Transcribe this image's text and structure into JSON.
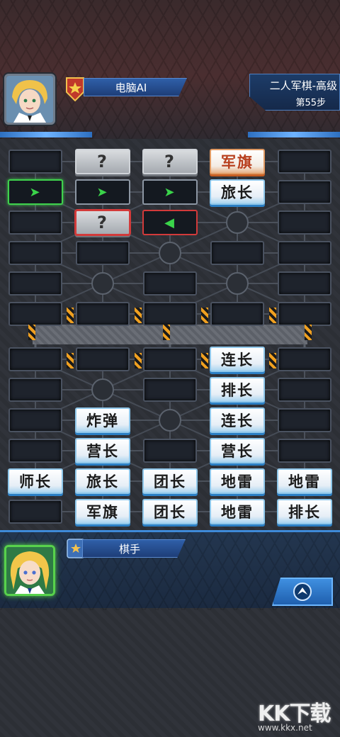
{
  "opponent": {
    "name": "电脑AI"
  },
  "game": {
    "title": "二人军棋-高级",
    "moves": "第55步"
  },
  "player": {
    "name": "棋手"
  },
  "icons": {
    "opponent_badge": "rank-badge-icon",
    "player_badge": "rank-badge-icon",
    "action": "up-arrow-icon"
  },
  "colors": {
    "accent_blue": "#3e8ad8",
    "selected_green": "#3fd14d",
    "highlight_red": "#d23a3a",
    "opp_text": "#b8401e"
  },
  "board": {
    "opponent_pieces": [
      {
        "row": 0,
        "col": 1,
        "label": "?",
        "kind": "hidden"
      },
      {
        "row": 0,
        "col": 2,
        "label": "?",
        "kind": "hidden"
      },
      {
        "row": 0,
        "col": 3,
        "label": "军旗",
        "kind": "revealed"
      },
      {
        "row": 1,
        "col": 0,
        "label": "➤",
        "kind": "marker-green"
      },
      {
        "row": 1,
        "col": 1,
        "label": "➤",
        "kind": "marker"
      },
      {
        "row": 1,
        "col": 2,
        "label": "➤",
        "kind": "marker"
      },
      {
        "row": 1,
        "col": 3,
        "label": "旅长",
        "kind": "mine"
      },
      {
        "row": 2,
        "col": 1,
        "label": "?",
        "kind": "hidden-red"
      },
      {
        "row": 2,
        "col": 2,
        "label": "◀",
        "kind": "marker-red"
      }
    ],
    "player_pieces": [
      {
        "row": 6,
        "col": 3,
        "label": "连长"
      },
      {
        "row": 7,
        "col": 3,
        "label": "排长"
      },
      {
        "row": 8,
        "col": 1,
        "label": "炸弹"
      },
      {
        "row": 8,
        "col": 3,
        "label": "连长"
      },
      {
        "row": 9,
        "col": 1,
        "label": "营长"
      },
      {
        "row": 9,
        "col": 3,
        "label": "营长"
      },
      {
        "row": 10,
        "col": 0,
        "label": "师长"
      },
      {
        "row": 10,
        "col": 1,
        "label": "旅长"
      },
      {
        "row": 10,
        "col": 2,
        "label": "团长"
      },
      {
        "row": 10,
        "col": 3,
        "label": "地雷"
      },
      {
        "row": 10,
        "col": 4,
        "label": "地雷"
      },
      {
        "row": 11,
        "col": 1,
        "label": "军旗"
      },
      {
        "row": 11,
        "col": 2,
        "label": "团长"
      },
      {
        "row": 11,
        "col": 3,
        "label": "地雷"
      },
      {
        "row": 11,
        "col": 4,
        "label": "排长"
      }
    ],
    "camps": [
      {
        "row": 2,
        "col": 3
      },
      {
        "row": 3,
        "col": 2
      },
      {
        "row": 4,
        "col": 1
      },
      {
        "row": 4,
        "col": 3
      },
      {
        "row": 7,
        "col": 1
      },
      {
        "row": 8,
        "col": 2
      }
    ]
  },
  "watermark": {
    "logo": "KK下载",
    "url": "www.kkx.net"
  }
}
